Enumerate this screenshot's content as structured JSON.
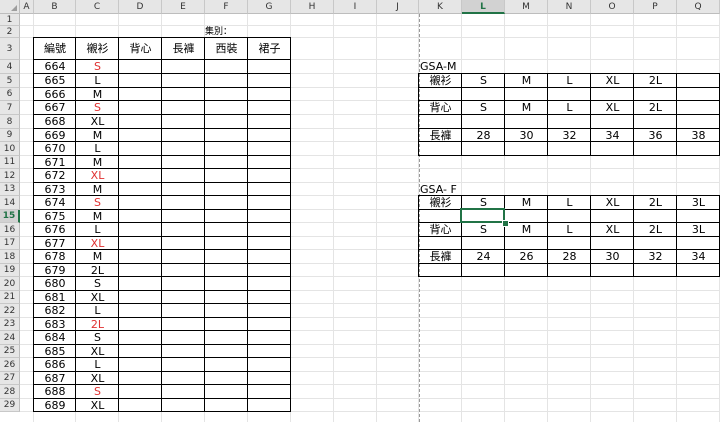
{
  "columns": [
    "A",
    "B",
    "C",
    "D",
    "E",
    "F",
    "G",
    "H",
    "I",
    "J",
    "K",
    "L",
    "M",
    "N",
    "O",
    "P",
    "Q"
  ],
  "rows": [
    "1",
    "2",
    "3",
    "4",
    "5",
    "6",
    "7",
    "8",
    "9",
    "10",
    "11",
    "12",
    "13",
    "14",
    "15",
    "16",
    "17",
    "18",
    "19",
    "20",
    "21",
    "22",
    "23",
    "24",
    "25",
    "26",
    "27",
    "28",
    "29"
  ],
  "selected_column": "L",
  "selected_row": "15",
  "left_table": {
    "top_label": "集別：",
    "headers": [
      "編號",
      "襯衫",
      "背心",
      "長褲",
      "西裝",
      "裙子"
    ],
    "records": [
      {
        "id": "664",
        "size": "S",
        "red": true
      },
      {
        "id": "665",
        "size": "L",
        "red": false
      },
      {
        "id": "666",
        "size": "M",
        "red": false
      },
      {
        "id": "667",
        "size": "S",
        "red": true
      },
      {
        "id": "668",
        "size": "XL",
        "red": false
      },
      {
        "id": "669",
        "size": "M",
        "red": false
      },
      {
        "id": "670",
        "size": "L",
        "red": false
      },
      {
        "id": "671",
        "size": "M",
        "red": false
      },
      {
        "id": "672",
        "size": "XL",
        "red": true
      },
      {
        "id": "673",
        "size": "M",
        "red": false
      },
      {
        "id": "674",
        "size": "S",
        "red": true
      },
      {
        "id": "675",
        "size": "M",
        "red": false
      },
      {
        "id": "676",
        "size": "L",
        "red": false
      },
      {
        "id": "677",
        "size": "XL",
        "red": true
      },
      {
        "id": "678",
        "size": "M",
        "red": false
      },
      {
        "id": "679",
        "size": "2L",
        "red": false
      },
      {
        "id": "680",
        "size": "S",
        "red": false
      },
      {
        "id": "681",
        "size": "XL",
        "red": false
      },
      {
        "id": "682",
        "size": "L",
        "red": false
      },
      {
        "id": "683",
        "size": "2L",
        "red": true
      },
      {
        "id": "684",
        "size": "S",
        "red": false
      },
      {
        "id": "685",
        "size": "XL",
        "red": false
      },
      {
        "id": "686",
        "size": "L",
        "red": false
      },
      {
        "id": "687",
        "size": "XL",
        "red": false
      },
      {
        "id": "688",
        "size": "S",
        "red": true
      },
      {
        "id": "689",
        "size": "XL",
        "red": false
      }
    ]
  },
  "size_tables": [
    {
      "title": "GSA-M",
      "rows": [
        {
          "label": "襯衫",
          "values": [
            "S",
            "M",
            "L",
            "XL",
            "2L",
            ""
          ]
        },
        {
          "label": "背心",
          "values": [
            "S",
            "M",
            "L",
            "XL",
            "2L",
            ""
          ]
        },
        {
          "label": "長褲",
          "values": [
            "28",
            "30",
            "32",
            "34",
            "36",
            "38"
          ]
        }
      ]
    },
    {
      "title": "GSA- F",
      "rows": [
        {
          "label": "襯衫",
          "values": [
            "S",
            "M",
            "L",
            "XL",
            "2L",
            "3L"
          ]
        },
        {
          "label": "背心",
          "values": [
            "S",
            "M",
            "L",
            "XL",
            "2L",
            "3L"
          ]
        },
        {
          "label": "長褲",
          "values": [
            "24",
            "26",
            "28",
            "30",
            "32",
            "34"
          ]
        }
      ]
    }
  ]
}
